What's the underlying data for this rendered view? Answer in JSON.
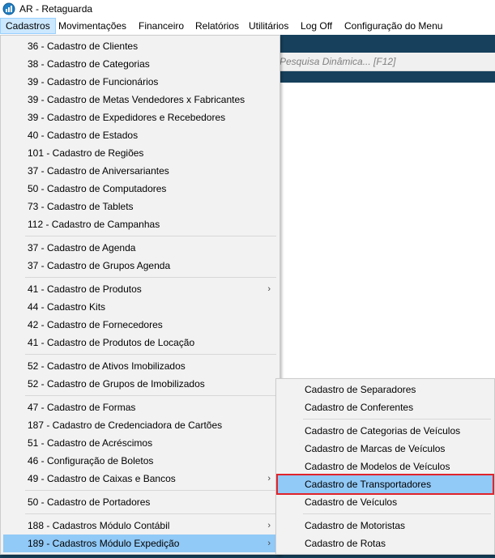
{
  "window": {
    "title": "AR - Retaguarda",
    "icon": "app-logo-icon"
  },
  "menubar": [
    {
      "label": "Cadastros"
    },
    {
      "label": "Movimentações"
    },
    {
      "label": "Financeiro"
    },
    {
      "label": "Relatórios"
    },
    {
      "label": "Utilitários"
    },
    {
      "label": "Log Off"
    },
    {
      "label": "Configuração do Menu"
    }
  ],
  "search": {
    "placeholder": "Pesquisa Dinâmica... [F12]"
  },
  "cadastros_menu": [
    "36 - Cadastro de Clientes",
    "38 - Cadastro de Categorias",
    "39 - Cadastro de Funcionários",
    "39 - Cadastro de Metas Vendedores x Fabricantes",
    "39 - Cadastro de Expedidores e Recebedores",
    "40 - Cadastro de Estados",
    "101 - Cadastro de Regiões",
    "37 - Cadastro de Aniversariantes",
    "50 - Cadastro de Computadores",
    "73 - Cadastro de Tablets",
    "112 - Cadastro de Campanhas",
    "37 - Cadastro de Agenda",
    "37 - Cadastro de Grupos Agenda",
    "41 - Cadastro de Produtos",
    "44 - Cadastro Kits",
    "42 - Cadastro de Fornecedores",
    "41 - Cadastro de Produtos de Locação",
    "52 - Cadastro de Ativos Imobilizados",
    "52 - Cadastro de Grupos de Imobilizados",
    "47 - Cadastro de Formas",
    "187 - Cadastro de Credenciadora de Cartões",
    "51 - Cadastro de Acréscimos",
    "46 - Configuração de Boletos",
    "49 - Cadastro de Caixas e Bancos",
    "50 - Cadastro de Portadores",
    "188 - Cadastros Módulo Contábil",
    "189 - Cadastros Módulo Expedição"
  ],
  "expedicao_submenu": [
    "Cadastro de Separadores",
    "Cadastro de Conferentes",
    "Cadastro de Categorias de Veículos",
    "Cadastro de Marcas de Veículos",
    "Cadastro de Modelos de Veículos",
    "Cadastro de Transportadores",
    "Cadastro de Veículos",
    "Cadastro de Motoristas",
    "Cadastro de Rotas"
  ],
  "submenu_arrow": "›",
  "colors": {
    "highlight": "#91c9f7",
    "red_box": "#e0242b",
    "band": "#16405c"
  }
}
